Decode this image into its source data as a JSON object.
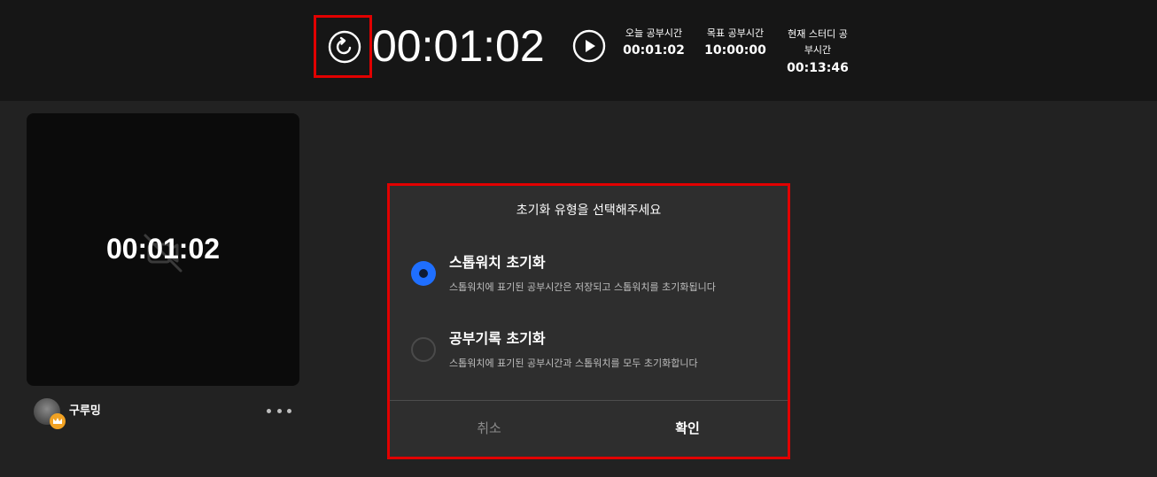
{
  "header": {
    "timer": "00:01:02",
    "stats": [
      {
        "label": "오늘 공부시간",
        "value": "00:01:02"
      },
      {
        "label": "목표 공부시간",
        "value": "10:00:00"
      },
      {
        "label": "현재 스터디 공부시간",
        "label_lines": [
          "현재 스터디 공",
          "부시간"
        ],
        "value": "00:13:46"
      }
    ]
  },
  "tile": {
    "time": "00:01:02",
    "username": "구루밍"
  },
  "modal": {
    "title": "초기화 유형을 선택해주세요",
    "options": [
      {
        "title": "스톱워치 초기화",
        "desc": "스톱워치에 표기된 공부시간은 저장되고 스톱워치를 초기화됩니다",
        "selected": true
      },
      {
        "title": "공부기록 초기화",
        "desc": "스톱워치에 표기된 공부시간과 스톱워치를 모두 초기화합니다",
        "selected": false
      }
    ],
    "cancel_label": "취소",
    "confirm_label": "확인"
  },
  "colors": {
    "accent": "#1f6fff",
    "highlight": "#e10000",
    "crown": "#f2a223"
  }
}
